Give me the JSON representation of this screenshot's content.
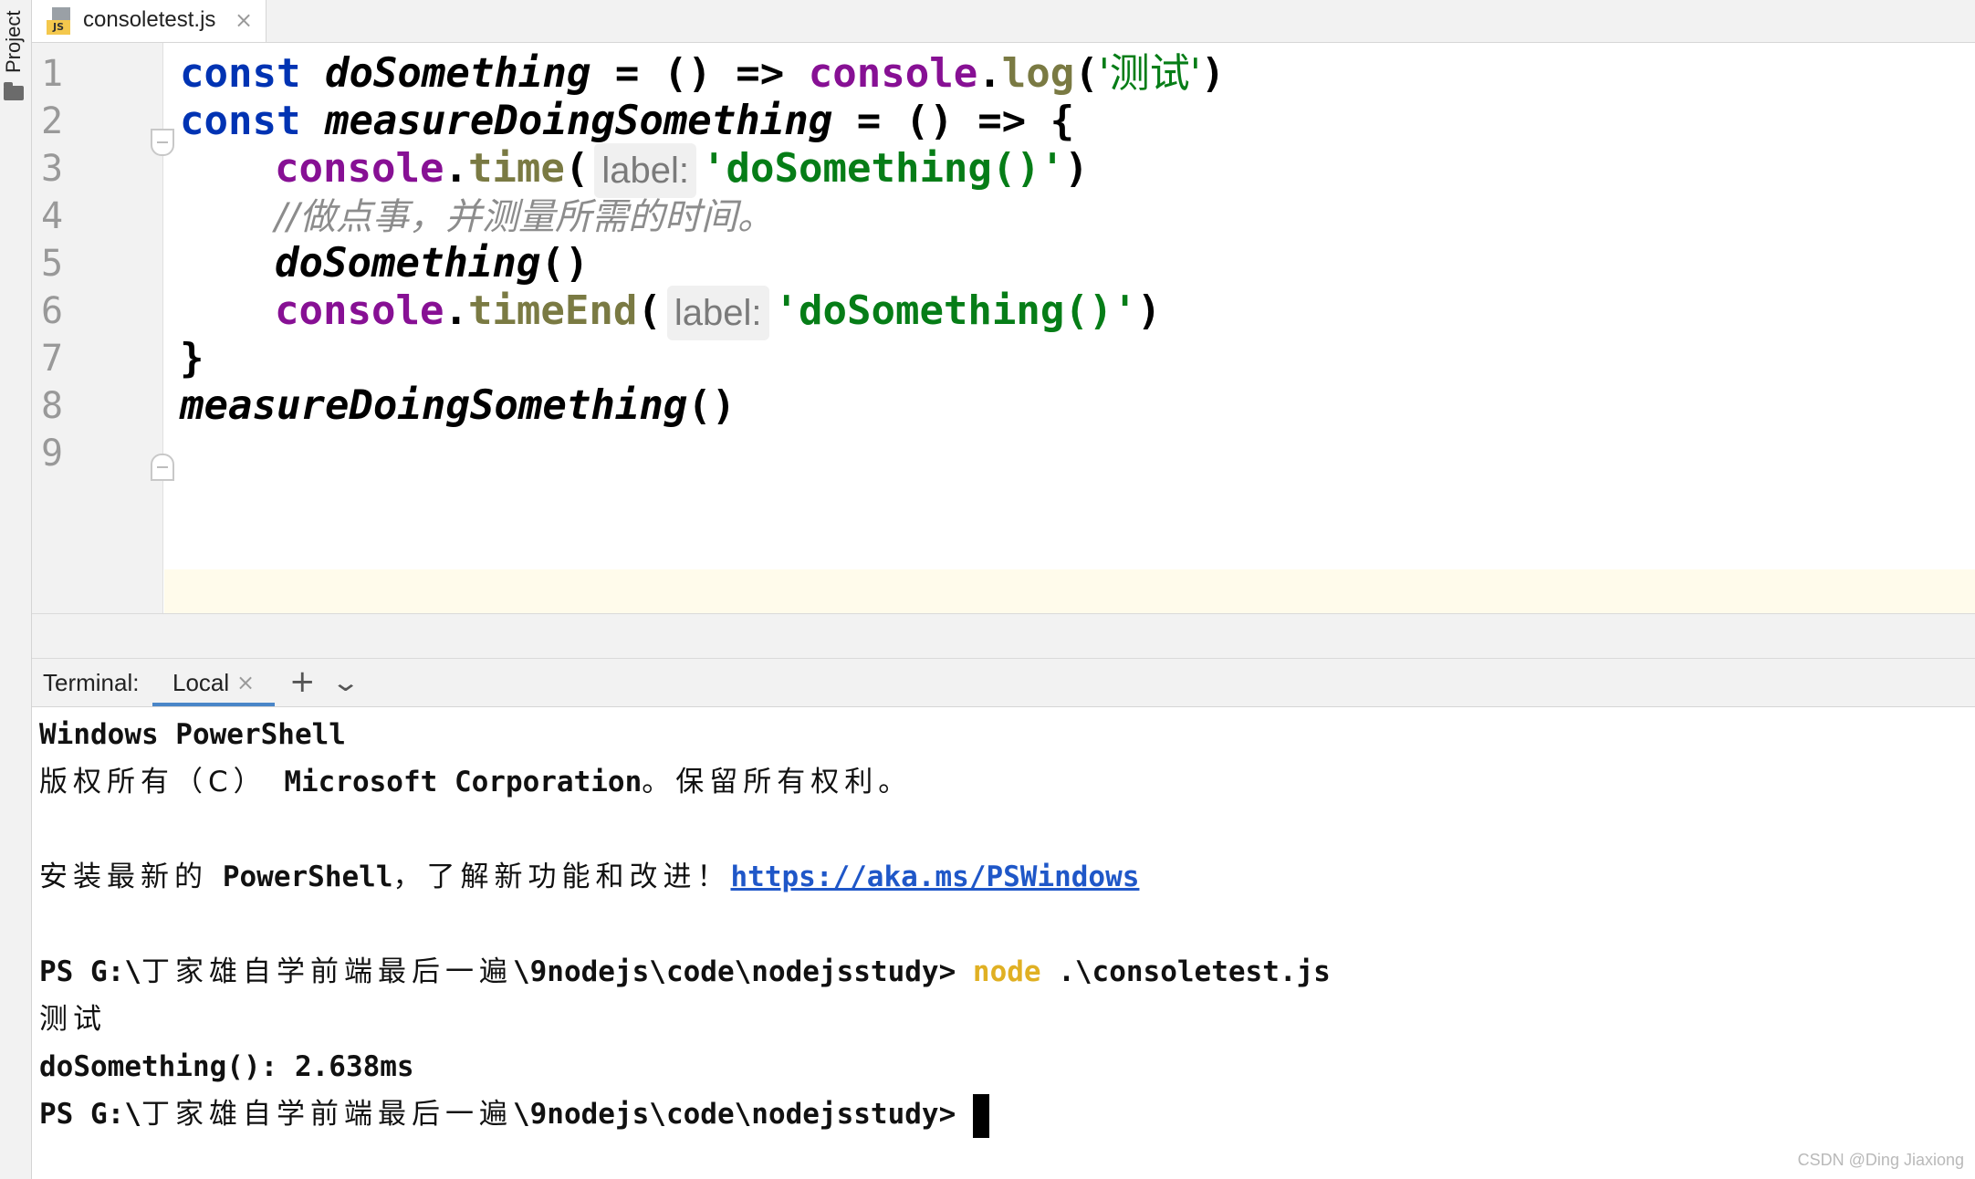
{
  "sidebar": {
    "project_label": "Project"
  },
  "editor": {
    "tab": {
      "filename": "consoletest.js",
      "icon": "js-file-icon",
      "close": "×"
    },
    "line_numbers": [
      "1",
      "2",
      "3",
      "4",
      "5",
      "6",
      "7",
      "8",
      "9"
    ],
    "lines": {
      "l1": {
        "kw": "const",
        "fn": "doSomething",
        "op": " = () => ",
        "obj": "console",
        "dot": ".",
        "meth": "log",
        "open": "(",
        "str": "'测试'",
        "close": ")"
      },
      "l2": {
        "kw": "const",
        "fn": "measureDoingSomething",
        "op": " = () => {"
      },
      "l3": {
        "obj": "console",
        "dot": ".",
        "meth": "time",
        "open": "(",
        "hint": "label:",
        "str": "'doSomething()'",
        "close": ")"
      },
      "l4": {
        "comment": "//做点事，并测量所需的时间。"
      },
      "l5": {
        "fn": "doSomething",
        "call": "()"
      },
      "l6": {
        "obj": "console",
        "dot": ".",
        "meth": "timeEnd",
        "open": "(",
        "hint": "label:",
        "str": "'doSomething()'",
        "close": ")"
      },
      "l7": {
        "brace": "}"
      },
      "l8": {
        "fn": "measureDoingSomething",
        "call": "()"
      }
    }
  },
  "terminal": {
    "title": "Terminal:",
    "tab_label": "Local",
    "tab_close": "×",
    "add": "+",
    "menu": "⌄",
    "lines": {
      "t1": "Windows PowerShell",
      "t2_cn1": "版权所有（C）",
      "t2_en": " Microsoft Corporation",
      "t2_cn2": "。保留所有权利。",
      "t3_cn1": "安装最新的 ",
      "t3_en": "PowerShell",
      "t3_cn2": "，了解新功能和改进！",
      "t3_link": "https://aka.ms/PSWindows",
      "t4_a": "PS G:\\",
      "t4_cn": "丁家雄自学前端最后一遍",
      "t4_b": "\\9nodejs\\code\\nodejsstudy> ",
      "t4_cmd": "node",
      "t4_arg": " .\\consoletest.js",
      "t5": "测试",
      "t6": "doSomething(): 2.638ms",
      "t7_a": "PS G:\\",
      "t7_cn": "丁家雄自学前端最后一遍",
      "t7_b": "\\9nodejs\\code\\nodejsstudy> "
    }
  },
  "watermark": "CSDN @Ding Jiaxiong",
  "colors": {
    "keyword": "#0033b3",
    "object": "#871094",
    "method": "#7a7a43",
    "string": "#067d17",
    "comment": "#8c8c8c",
    "link": "#1f57c8",
    "command": "#e0b023"
  }
}
